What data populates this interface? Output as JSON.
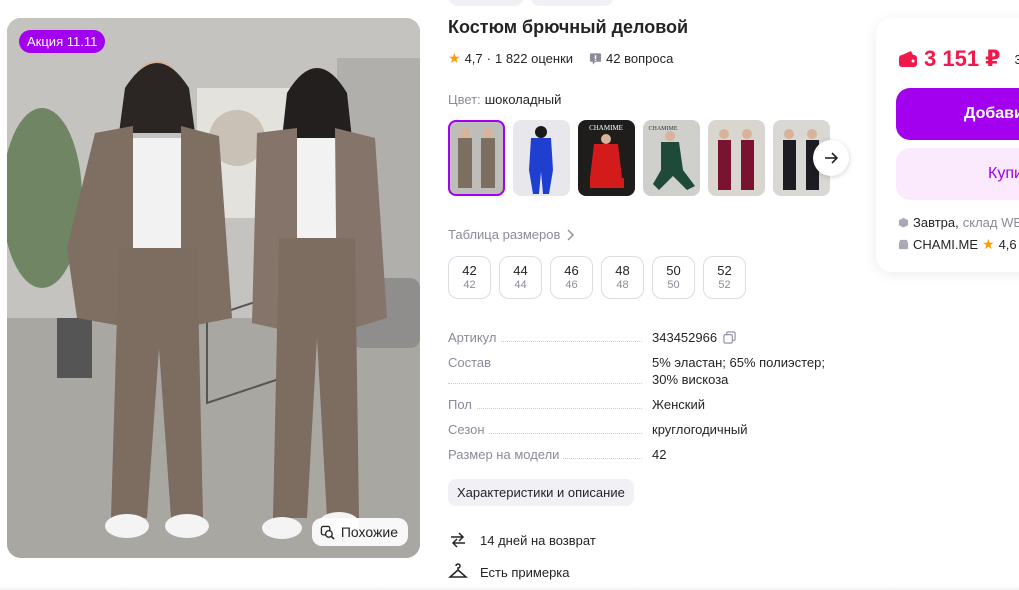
{
  "promo_badge": "Акция 11.11",
  "similar_button": "Похожие",
  "product": {
    "title": "Костюм брючный деловой",
    "rating": "4,7",
    "reviews": "1 822 оценки",
    "questions": "42 вопроса",
    "color_label": "Цвет:",
    "color_value": "шоколадный",
    "thumbnails": [
      {
        "name": "brown suit",
        "color": "#7d6e62"
      },
      {
        "name": "blue suit",
        "color": "#1f3fd1"
      },
      {
        "name": "red suit",
        "color": "#d31b1b"
      },
      {
        "name": "green suit",
        "color": "#1f4a3a"
      },
      {
        "name": "burgundy suit",
        "color": "#7a1330"
      },
      {
        "name": "black suit",
        "color": "#1c1c22"
      }
    ],
    "thumbnail_text": "CHAMIME"
  },
  "size_table_link": "Таблица размеров",
  "sizes": [
    {
      "main": "42",
      "sub": "42"
    },
    {
      "main": "44",
      "sub": "44"
    },
    {
      "main": "46",
      "sub": "46"
    },
    {
      "main": "48",
      "sub": "48"
    },
    {
      "main": "50",
      "sub": "50"
    },
    {
      "main": "52",
      "sub": "52"
    }
  ],
  "specs": [
    {
      "name": "Артикул",
      "value": "343452966"
    },
    {
      "name": "Состав",
      "value": "5% эластан; 65% полиэстер; 30% вискоза"
    },
    {
      "name": "Пол",
      "value": "Женский"
    },
    {
      "name": "Сезон",
      "value": "круглогодичный"
    },
    {
      "name": "Размер на модели",
      "value": "42"
    }
  ],
  "characteristics_button": "Характеристики и описание",
  "services": [
    {
      "label": "14 дней на возврат",
      "icon": "return-arrows-icon"
    },
    {
      "label": "Есть примерка",
      "icon": "hanger-icon"
    }
  ],
  "buy_card": {
    "price": "3 151 ₽",
    "old_price": "3",
    "add_button": "Добавить",
    "buy_button": "Купить",
    "delivery_day": "Завтра,",
    "delivery_place": "склад WB",
    "seller": "CHAMI.ME",
    "seller_rating": "4,6"
  },
  "colors": {
    "accent": "#a300f0",
    "price": "#f0194b",
    "muted": "#8b8b99"
  }
}
